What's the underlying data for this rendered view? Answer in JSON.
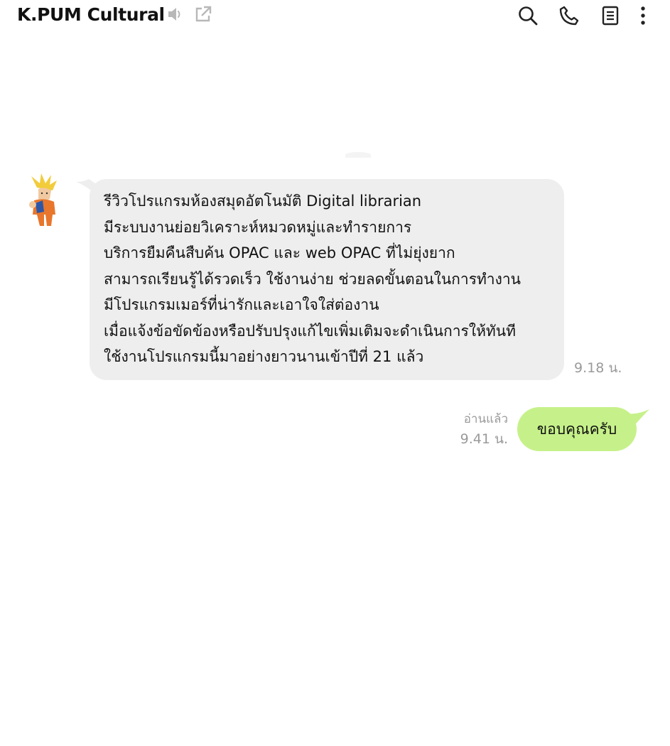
{
  "header": {
    "title": "K.PUM Cultural",
    "title_icons": [
      {
        "icon": "speaker-icon",
        "state": "muted-gray"
      },
      {
        "icon": "open-external-icon",
        "state": "gray"
      }
    ],
    "actions": [
      {
        "icon": "search-icon"
      },
      {
        "icon": "phone-icon"
      },
      {
        "icon": "notes-icon"
      },
      {
        "icon": "more-vertical-icon"
      }
    ]
  },
  "messages": [
    {
      "direction": "incoming",
      "sender_avatar": "avatar-icon",
      "lines": [
        "รีวิวโปรแกรมห้องสมุดอัตโนมัติ Digital librarian",
        "มีระบบงานย่อยวิเคราะห์หมวดหมู่และทำรายการ",
        "บริการยืมคืนสืบค้น OPAC และ web OPAC ที่ไม่ยุ่งยาก",
        "สามารถเรียนรู้ได้รวดเร็ว ใช้งานง่าย ช่วยลดขั้นตอนในการทำงาน",
        "มีโปรแกรมเมอร์ที่น่ารักและเอาใจใส่ต่องาน",
        "เมื่อแจ้งข้อขัดข้องหรือปรับปรุงแก้ไขเพิ่มเติมจะดำเนินการให้ทันที",
        "ใช้งานโปรแกรมนี้มาอย่างยาวนานเข้าปีที่ 21 แล้ว"
      ],
      "time": "9.18 น."
    },
    {
      "direction": "outgoing",
      "text": "ขอบคุณครับ",
      "read_label": "อ่านแล้ว",
      "time": "9.41 น."
    }
  ],
  "colors": {
    "incoming_bubble": "#eeeeee",
    "outgoing_bubble": "#c6f18a",
    "meta_text": "#9a9a9a",
    "icon_dark": "#222222",
    "icon_gray": "#b8b8b8"
  }
}
